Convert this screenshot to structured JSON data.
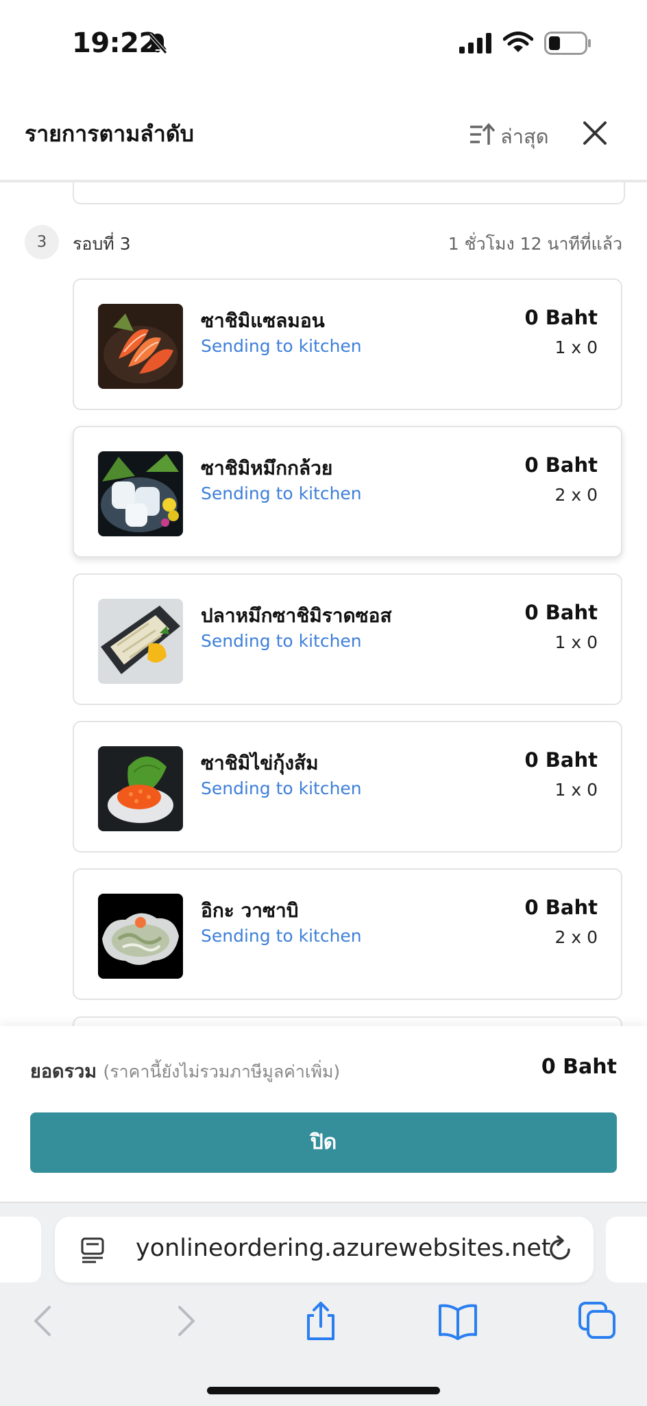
{
  "status_bar": {
    "time": "19:22"
  },
  "header": {
    "title": "รายการตามลำดับ",
    "sort_label": "ล่าสุด"
  },
  "round": {
    "number": "3",
    "label": "รอบที่ 3",
    "time_ago": "1 ชั่วโมง 12 นาทีที่แล้ว"
  },
  "items": [
    {
      "name": "ซาชิมิแซลมอน",
      "status": "Sending to kitchen",
      "price": "0 Baht",
      "qty": "1 x 0"
    },
    {
      "name": "ซาชิมิหมึกกล้วย",
      "status": "Sending to kitchen",
      "price": "0 Baht",
      "qty": "2 x 0"
    },
    {
      "name": "ปลาหมึกซาชิมิราดซอส",
      "status": "Sending to kitchen",
      "price": "0 Baht",
      "qty": "1 x 0"
    },
    {
      "name": "ซาชิมิไข่กุ้งส้ม",
      "status": "Sending to kitchen",
      "price": "0 Baht",
      "qty": "1 x 0"
    },
    {
      "name": "อิกะ วาซาบิ",
      "status": "Sending to kitchen",
      "price": "0 Baht",
      "qty": "2 x 0"
    }
  ],
  "footer": {
    "total_label": "ยอดรวม",
    "total_note": "(ราคานี้ยังไม่รวมภาษีมูลค่าเพิ่ม)",
    "total_amount": "0 Baht",
    "close_button": "ปิด"
  },
  "browser": {
    "url": "yonlineordering.azurewebsites.net"
  },
  "colors": {
    "accent_status": "#3d7fd9",
    "button": "#358f9b"
  },
  "icons": [
    "bell-slash-icon",
    "signal-icon",
    "wifi-icon",
    "battery-icon",
    "sort-icon",
    "close-icon",
    "reader-icon",
    "reload-icon",
    "back-icon",
    "forward-icon",
    "share-icon",
    "bookmarks-icon",
    "tabs-icon"
  ]
}
